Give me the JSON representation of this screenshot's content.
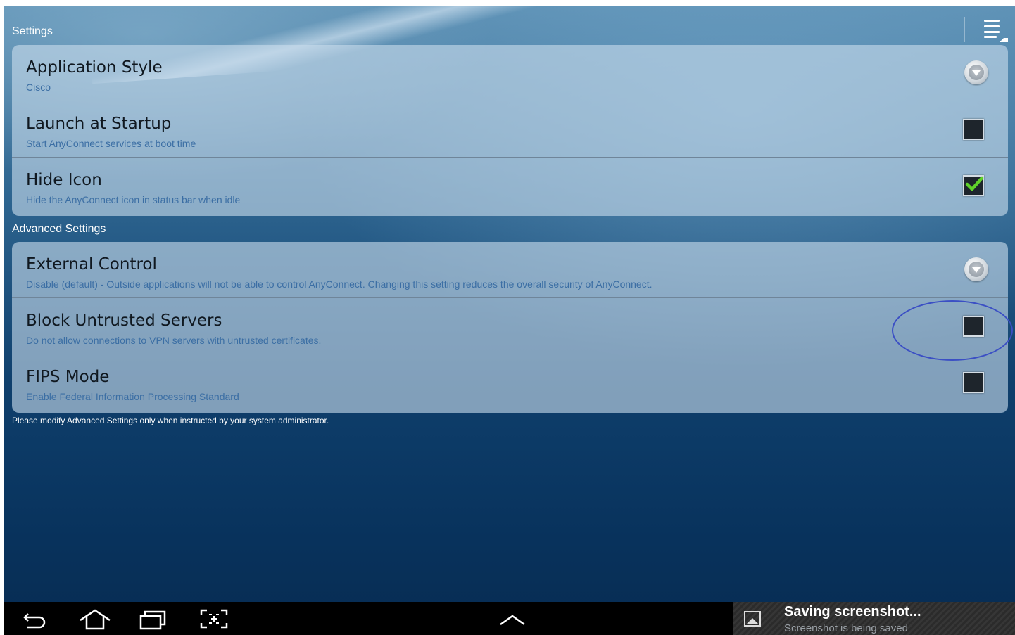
{
  "header": {
    "section_label": "Settings",
    "menu_icon": "overflow-menu-icon"
  },
  "settings": [
    {
      "title": "Application Style",
      "subtitle": "Cisco",
      "control": "dropdown"
    },
    {
      "title": "Launch at Startup",
      "subtitle": "Start AnyConnect services at boot time",
      "control": "checkbox",
      "checked": false
    },
    {
      "title": "Hide Icon",
      "subtitle": "Hide the AnyConnect icon in status bar when idle",
      "control": "checkbox",
      "checked": true
    }
  ],
  "advanced": {
    "section_label": "Advanced Settings",
    "items": [
      {
        "title": "External Control",
        "subtitle": "Disable (default) - Outside applications will not be able to control AnyConnect. Changing this setting reduces the overall security of AnyConnect.",
        "control": "dropdown"
      },
      {
        "title": "Block Untrusted Servers",
        "subtitle": "Do not allow connections to VPN servers with untrusted certificates.",
        "control": "checkbox",
        "checked": false
      },
      {
        "title": "FIPS Mode",
        "subtitle": "Enable Federal Information Processing Standard",
        "control": "checkbox",
        "checked": false
      }
    ],
    "footer_note": "Please modify Advanced Settings only when instructed by your system administrator."
  },
  "navbar": {
    "buttons": [
      "back-icon",
      "home-icon",
      "recent-apps-icon",
      "screenshot-icon",
      "chevron-up-icon"
    ]
  },
  "notification": {
    "icon": "image-icon",
    "title": "Saving screenshot...",
    "subtitle": "Screenshot is being saved"
  },
  "colors": {
    "accent_check": "#5fd12a",
    "subtitle_text": "#3b6ea4",
    "annotation_circle": "#3b4fc4"
  }
}
